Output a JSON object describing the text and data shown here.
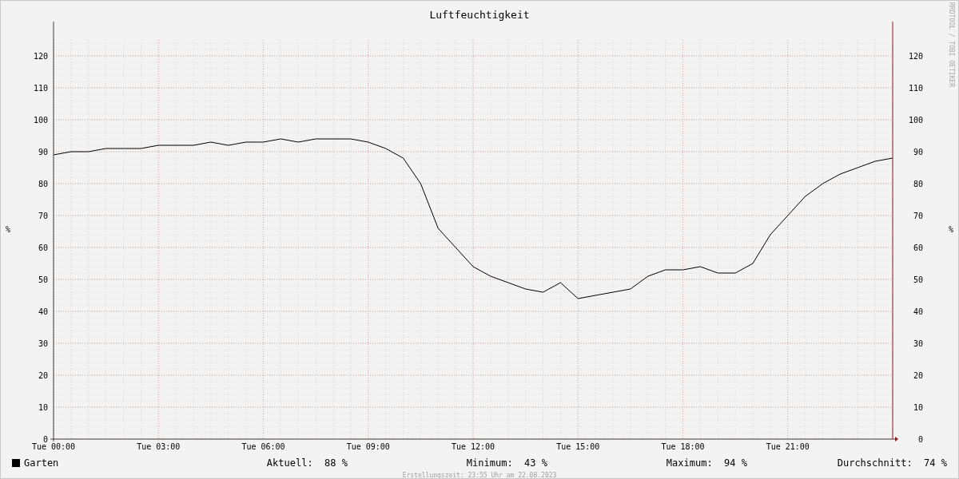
{
  "chart": {
    "chart_data": {
      "type": "line",
      "title": "Luftfeuchtigkeit",
      "ylabel": "%",
      "categories": [
        "Tue 00:00",
        null,
        null,
        null,
        null,
        null,
        "Tue 03:00",
        null,
        null,
        null,
        null,
        null,
        "Tue 06:00",
        null,
        null,
        null,
        null,
        null,
        "Tue 09:00",
        null,
        null,
        null,
        null,
        null,
        "Tue 12:00",
        null,
        null,
        null,
        null,
        null,
        "Tue 15:00",
        null,
        null,
        null,
        null,
        null,
        "Tue 18:00",
        null,
        null,
        null,
        null,
        null,
        "Tue 21:00",
        null,
        null,
        null,
        null,
        null,
        null
      ],
      "series": [
        {
          "name": "Garten",
          "color": "#000000",
          "values": [
            89,
            90,
            90,
            91,
            91,
            91,
            92,
            92,
            92,
            93,
            92,
            93,
            93,
            94,
            93,
            94,
            94,
            94,
            93,
            91,
            88,
            80,
            66,
            60,
            54,
            51,
            49,
            47,
            46,
            49,
            44,
            45,
            46,
            47,
            51,
            53,
            53,
            54,
            52,
            52,
            55,
            64,
            70,
            76,
            80,
            83,
            85,
            87,
            88
          ]
        }
      ],
      "ylim": [
        0,
        125
      ],
      "grid": true,
      "yticks": [
        0,
        10,
        20,
        30,
        40,
        50,
        60,
        70,
        80,
        90,
        100,
        110,
        120
      ]
    },
    "right_ticks": [
      "120",
      "110",
      "100",
      "90",
      "80",
      "70",
      "60",
      "50",
      "40",
      "30",
      "20",
      "10",
      "0"
    ],
    "right_axis_label": "%",
    "credit": "RRDTOOL / TOBI OETIKER"
  },
  "stats": [
    {
      "label": "Aktuell:",
      "value": "88 %"
    },
    {
      "label": "Minimum:",
      "value": "43 %"
    },
    {
      "label": "Maximum:",
      "value": "94 %"
    },
    {
      "label": "Durchschnitt:",
      "value": "74 %"
    }
  ],
  "footer": "Erstellungszeit: 23:55 Uhr am 22.08.2023"
}
